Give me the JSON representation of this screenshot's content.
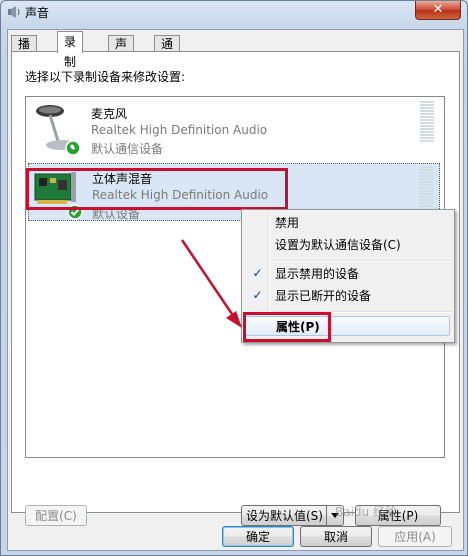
{
  "window": {
    "title": "声音",
    "close_label": "✕"
  },
  "tabs": [
    {
      "label": "播放",
      "active": false
    },
    {
      "label": "录制",
      "active": true
    },
    {
      "label": "声音",
      "active": false
    },
    {
      "label": "通信",
      "active": false
    }
  ],
  "instruction": "选择以下录制设备来修改设置:",
  "devices": [
    {
      "name": "麦克风",
      "driver": "Realtek High Definition Audio",
      "status": "默认通信设备",
      "icon": "microphone-icon"
    },
    {
      "name": "立体声混音",
      "driver": "Realtek High Definition Audio",
      "status": "默认设备",
      "icon": "sound-card-icon"
    }
  ],
  "context_menu": {
    "items": [
      {
        "label": "禁用",
        "checked": false
      },
      {
        "label": "设置为默认通信设备(C)",
        "checked": false
      },
      {
        "label": "显示禁用的设备",
        "checked": true
      },
      {
        "label": "显示已断开的设备",
        "checked": true
      },
      {
        "label": "属性(P)",
        "checked": false,
        "highlighted": true
      }
    ],
    "check_glyph": "✓"
  },
  "buttons": {
    "configure": "配置(C)",
    "set_default": "设为默认值(S)",
    "properties": "属性(P)",
    "ok": "确定",
    "cancel": "取消",
    "apply": "应用(A)"
  },
  "watermark": "Baidu 经验",
  "colors": {
    "annotation_red": "#c8102e",
    "selection": "#d9e6f5",
    "status_green": "#2aa130"
  }
}
